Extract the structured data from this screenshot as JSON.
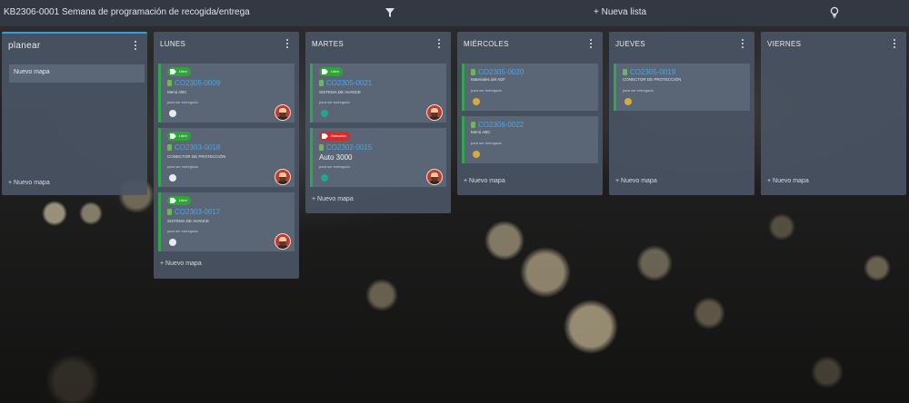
{
  "topbar": {
    "title": "KB2306-0001 Semana de programación de recogida/entrega",
    "new_list": "+ Nueva lista",
    "filter_icon": "filter-icon",
    "bulb_icon": "lightbulb-icon"
  },
  "colors": {
    "accent": "#29a3e3",
    "card_bar": "#2ea84a",
    "tag_green": "#2da637",
    "tag_red": "#d42b2b",
    "dot_white": "#e8eaee",
    "dot_teal": "#1fa98a",
    "dot_yellow": "#d7a941",
    "link": "#4aa6e9"
  },
  "columns": [
    {
      "title": "planear",
      "placeholder": "Nuevo mapa",
      "new_map": "+ Nuevo mapa",
      "cards": []
    },
    {
      "title": "LUNES",
      "new_map": "+ Nuevo mapa",
      "cards": [
        {
          "tag": "Libre",
          "id": "CO2305-0009",
          "subtitle": "Menú ABC",
          "meta": "para ser entregado",
          "status": "white"
        },
        {
          "tag": "Libre",
          "id": "CO2303-0018",
          "subtitle": "CONECTOR DE PROTECCIÓN",
          "meta": "para ser entregado",
          "status": "white"
        },
        {
          "tag": "Libre",
          "id": "CO2303-0017",
          "subtitle": "SISTEMA DE AVANCE",
          "meta": "para ser entregado",
          "status": "white"
        }
      ]
    },
    {
      "title": "MARTES",
      "new_map": "+ Nuevo mapa",
      "cards": [
        {
          "tag": "Libre",
          "id": "CO2305-0021",
          "subtitle": "SISTEMA DE AVANCE",
          "meta": "para ser entregado",
          "status": "teal"
        },
        {
          "tag": "Dirección",
          "id": "CO2302-0015",
          "subtitle": "Auto 3000",
          "meta": "para ser entregado",
          "status": "teal"
        }
      ]
    },
    {
      "title": "MIÉRCOLES",
      "new_map": "+ Nuevo mapa",
      "cards": [
        {
          "id": "CO2305-0020",
          "subtitle": "Materiales del ADF",
          "meta": "para ser entregado",
          "status": "yellow"
        },
        {
          "id": "CO2306-0022",
          "subtitle": "Menú ABC",
          "meta": "para ser entregado",
          "status": "yellow"
        }
      ]
    },
    {
      "title": "JUEVES",
      "new_map": "+ Nuevo mapa",
      "cards": [
        {
          "id": "CO2305-0019",
          "subtitle": "CONECTOR DE PROTECCIÓN",
          "meta": "para ser entregado",
          "status": "yellow"
        }
      ]
    },
    {
      "title": "VIERNES",
      "new_map": "+ Nuevo mapa",
      "cards": []
    }
  ]
}
